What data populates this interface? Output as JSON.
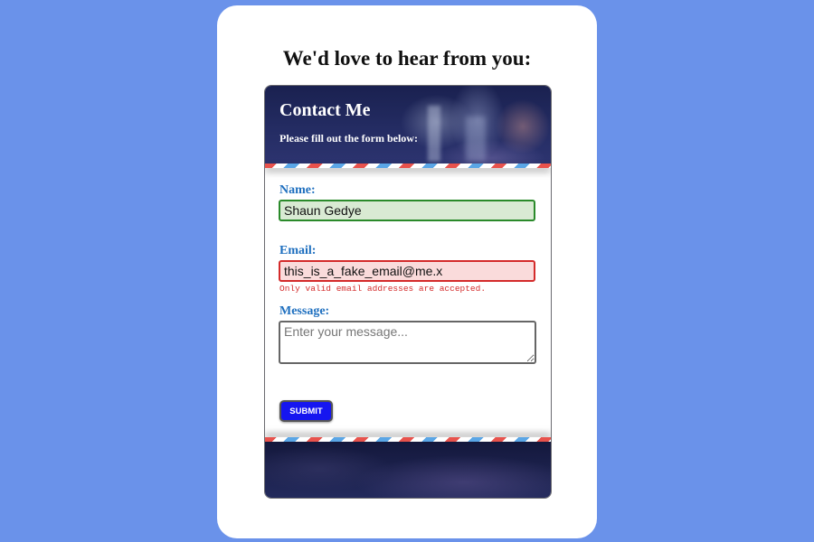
{
  "page": {
    "heading": "We'd love to hear from you:"
  },
  "card": {
    "title": "Contact Me",
    "subtitle": "Please fill out the form below:"
  },
  "form": {
    "name": {
      "label": "Name:",
      "value": "Shaun Gedye"
    },
    "email": {
      "label": "Email:",
      "value": "this_is_a_fake_email@me.x",
      "error": "Only valid email addresses are accepted."
    },
    "message": {
      "label": "Message:",
      "placeholder": "Enter your message...",
      "value": ""
    },
    "submit_label": "SUBMIT"
  },
  "colors": {
    "background": "#6a92ea",
    "label": "#1e6fbf",
    "valid_border": "#2a8a2a",
    "valid_fill": "#d9ead3",
    "error_border": "#d42b2b",
    "error_fill": "#fadbdb",
    "submit": "#1616f0"
  }
}
